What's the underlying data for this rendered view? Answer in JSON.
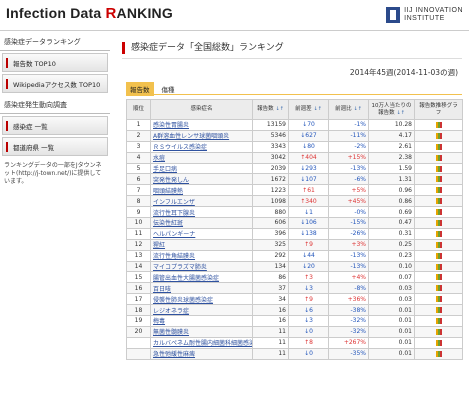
{
  "header": {
    "logo_prefix": "Infection Data ",
    "logo_r": "R",
    "logo_suffix": "ANKING",
    "iij_line1": "IIJ INNOVATION",
    "iij_line2": "INSTITUTE"
  },
  "sidebar": {
    "section1": "感染症データランキング",
    "items1": [
      "報告数 TOP10",
      "Wikipediaアクセス数 TOP10"
    ],
    "section2": "感染症発生動向調査",
    "items2": [
      "感染症 一覧",
      "都道府県 一覧"
    ],
    "note": "ランキングデータの一部をJタウンネット(http://j-town.net/)に提供しています。"
  },
  "main": {
    "title": "感染症データ「全国総数」ランキング",
    "week": "2014年45週(2014-11-03の週)",
    "tabs": [
      "報告数",
      "傷種"
    ],
    "columns": [
      "順位",
      "感染症名",
      "報告数",
      "前週差",
      "前週比",
      "10万人当たりの報告数",
      "報告数推移グラフ"
    ],
    "sort_marks": "↓↑",
    "rows": [
      {
        "rank": "1",
        "name": "感染性胃腸炎",
        "count": "13159",
        "diff": "70",
        "dir": "down",
        "ratio": "-1%",
        "per100k": "10.28"
      },
      {
        "rank": "2",
        "name": "A群溶血性レンサ球菌咽頭炎",
        "count": "5346",
        "diff": "627",
        "dir": "down",
        "ratio": "-11%",
        "per100k": "4.17"
      },
      {
        "rank": "3",
        "name": "ＲＳウイルス感染症",
        "count": "3343",
        "diff": "80",
        "dir": "down",
        "ratio": "-2%",
        "per100k": "2.61"
      },
      {
        "rank": "4",
        "name": "水痘",
        "count": "3042",
        "diff": "404",
        "dir": "up",
        "ratio": "+15%",
        "per100k": "2.38"
      },
      {
        "rank": "5",
        "name": "手足口病",
        "count": "2039",
        "diff": "293",
        "dir": "down",
        "ratio": "-13%",
        "per100k": "1.59"
      },
      {
        "rank": "6",
        "name": "突発性発しん",
        "count": "1672",
        "diff": "107",
        "dir": "down",
        "ratio": "-6%",
        "per100k": "1.31"
      },
      {
        "rank": "7",
        "name": "咽頭結膜熱",
        "count": "1223",
        "diff": "61",
        "dir": "up",
        "ratio": "+5%",
        "per100k": "0.96"
      },
      {
        "rank": "8",
        "name": "インフルエンザ",
        "count": "1098",
        "diff": "340",
        "dir": "up",
        "ratio": "+45%",
        "per100k": "0.86"
      },
      {
        "rank": "9",
        "name": "流行性耳下腺炎",
        "count": "880",
        "diff": "1",
        "dir": "down",
        "ratio": "-0%",
        "per100k": "0.69"
      },
      {
        "rank": "10",
        "name": "伝染性紅斑",
        "count": "606",
        "diff": "106",
        "dir": "down",
        "ratio": "-15%",
        "per100k": "0.47"
      },
      {
        "rank": "11",
        "name": "ヘルパンギーナ",
        "count": "396",
        "diff": "138",
        "dir": "down",
        "ratio": "-26%",
        "per100k": "0.31"
      },
      {
        "rank": "12",
        "name": "猩紅",
        "count": "325",
        "diff": "9",
        "dir": "up",
        "ratio": "+3%",
        "per100k": "0.25"
      },
      {
        "rank": "13",
        "name": "流行性角結膜炎",
        "count": "292",
        "diff": "44",
        "dir": "down",
        "ratio": "-13%",
        "per100k": "0.23"
      },
      {
        "rank": "14",
        "name": "マイコプラズマ肺炎",
        "count": "134",
        "diff": "20",
        "dir": "down",
        "ratio": "-13%",
        "per100k": "0.10"
      },
      {
        "rank": "15",
        "name": "腸管出血性大腸菌感染症",
        "count": "86",
        "diff": "3",
        "dir": "up",
        "ratio": "+4%",
        "per100k": "0.07"
      },
      {
        "rank": "16",
        "name": "百日咳",
        "count": "37",
        "diff": "3",
        "dir": "down",
        "ratio": "-8%",
        "per100k": "0.03"
      },
      {
        "rank": "17",
        "name": "侵襲性肺炎球菌感染症",
        "count": "34",
        "diff": "9",
        "dir": "up",
        "ratio": "+36%",
        "per100k": "0.03"
      },
      {
        "rank": "18",
        "name": "レジオネラ症",
        "count": "16",
        "diff": "6",
        "dir": "down",
        "ratio": "-38%",
        "per100k": "0.01"
      },
      {
        "rank": "19",
        "name": "梅毒",
        "count": "16",
        "diff": "3",
        "dir": "down",
        "ratio": "-32%",
        "per100k": "0.01"
      },
      {
        "rank": "20",
        "name": "無菌性髄膜炎",
        "count": "11",
        "diff": "0",
        "dir": "down",
        "ratio": "-32%",
        "per100k": "0.01"
      },
      {
        "rank": "",
        "name": "カルバペネム耐性腸内細菌科細菌感染症",
        "count": "11",
        "diff": "8",
        "dir": "up",
        "ratio": "+267%",
        "per100k": "0.01"
      },
      {
        "rank": "",
        "name": "急性弛緩性麻痺",
        "count": "11",
        "diff": "0",
        "dir": "down",
        "ratio": "-35%",
        "per100k": "0.01"
      }
    ]
  },
  "colors": {
    "accent": "#c00000",
    "tab_active": "#f2c14e",
    "link": "#2f52a0",
    "up": "#dd3333",
    "down": "#2255bb"
  },
  "icons": {
    "graph": "bar-chart-icon",
    "up_arrow": "up-arrow-icon",
    "down_arrow": "down-arrow-icon"
  }
}
